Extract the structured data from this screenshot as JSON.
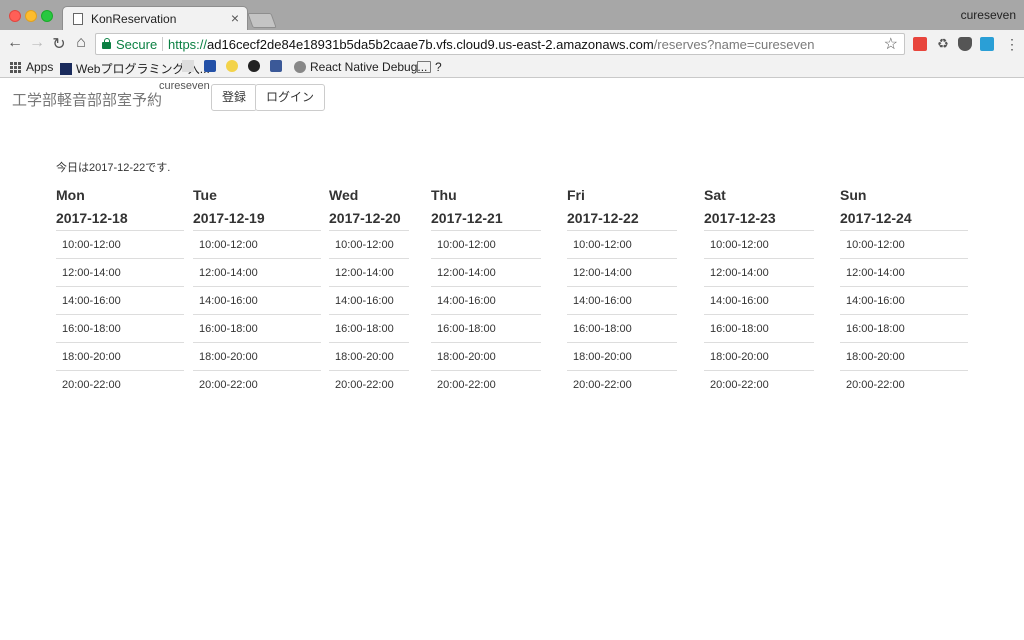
{
  "browser": {
    "tab_title": "KonReservation",
    "tab_close": "×",
    "profile_name": "cureseven",
    "address": {
      "secure_label": "Secure",
      "scheme": "https://",
      "host": "ad16cecf2de84e18931b5da5b2caae7b.vfs.cloud9.us-east-2.amazonaws.com",
      "path": "/reserves?name=cureseven"
    },
    "bookmarks": [
      {
        "label": "Apps",
        "icon": "apps-grid-icon"
      },
      {
        "label": "Webプログラミング 入...",
        "icon": "bookmark-icon"
      },
      {
        "label": "",
        "icon": "bookmark-icon"
      },
      {
        "label": "",
        "icon": "home-icon"
      },
      {
        "label": "",
        "icon": "bookmark-icon"
      },
      {
        "label": "",
        "icon": "github-icon"
      },
      {
        "label": "",
        "icon": "facebook-icon"
      },
      {
        "label": "React Native Debug...",
        "icon": "gear-icon"
      },
      {
        "label": "?",
        "icon": "folder-icon"
      }
    ]
  },
  "app": {
    "brand": "工学部軽音部部室予約",
    "username": "cureseven",
    "register_label": "登録",
    "login_label": "ログイン",
    "today_text": "今日は2017-12-22です."
  },
  "schedule": [
    {
      "day": "Mon",
      "date": "2017-12-18",
      "slots": [
        "10:00-12:00",
        "12:00-14:00",
        "14:00-16:00",
        "16:00-18:00",
        "18:00-20:00",
        "20:00-22:00"
      ]
    },
    {
      "day": "Tue",
      "date": "2017-12-19",
      "slots": [
        "10:00-12:00",
        "12:00-14:00",
        "14:00-16:00",
        "16:00-18:00",
        "18:00-20:00",
        "20:00-22:00"
      ]
    },
    {
      "day": "Wed",
      "date": "2017-12-20",
      "slots": [
        "10:00-12:00",
        "12:00-14:00",
        "14:00-16:00",
        "16:00-18:00",
        "18:00-20:00",
        "20:00-22:00"
      ]
    },
    {
      "day": "Thu",
      "date": "2017-12-21",
      "slots": [
        "10:00-12:00",
        "12:00-14:00",
        "14:00-16:00",
        "16:00-18:00",
        "18:00-20:00",
        "20:00-22:00"
      ]
    },
    {
      "day": "Fri",
      "date": "2017-12-22",
      "slots": [
        "10:00-12:00",
        "12:00-14:00",
        "14:00-16:00",
        "16:00-18:00",
        "18:00-20:00",
        "20:00-22:00"
      ]
    },
    {
      "day": "Sat",
      "date": "2017-12-23",
      "slots": [
        "10:00-12:00",
        "12:00-14:00",
        "14:00-16:00",
        "16:00-18:00",
        "18:00-20:00",
        "20:00-22:00"
      ]
    },
    {
      "day": "Sun",
      "date": "2017-12-24",
      "slots": [
        "10:00-12:00",
        "12:00-14:00",
        "14:00-16:00",
        "16:00-18:00",
        "18:00-20:00",
        "20:00-22:00"
      ]
    }
  ]
}
